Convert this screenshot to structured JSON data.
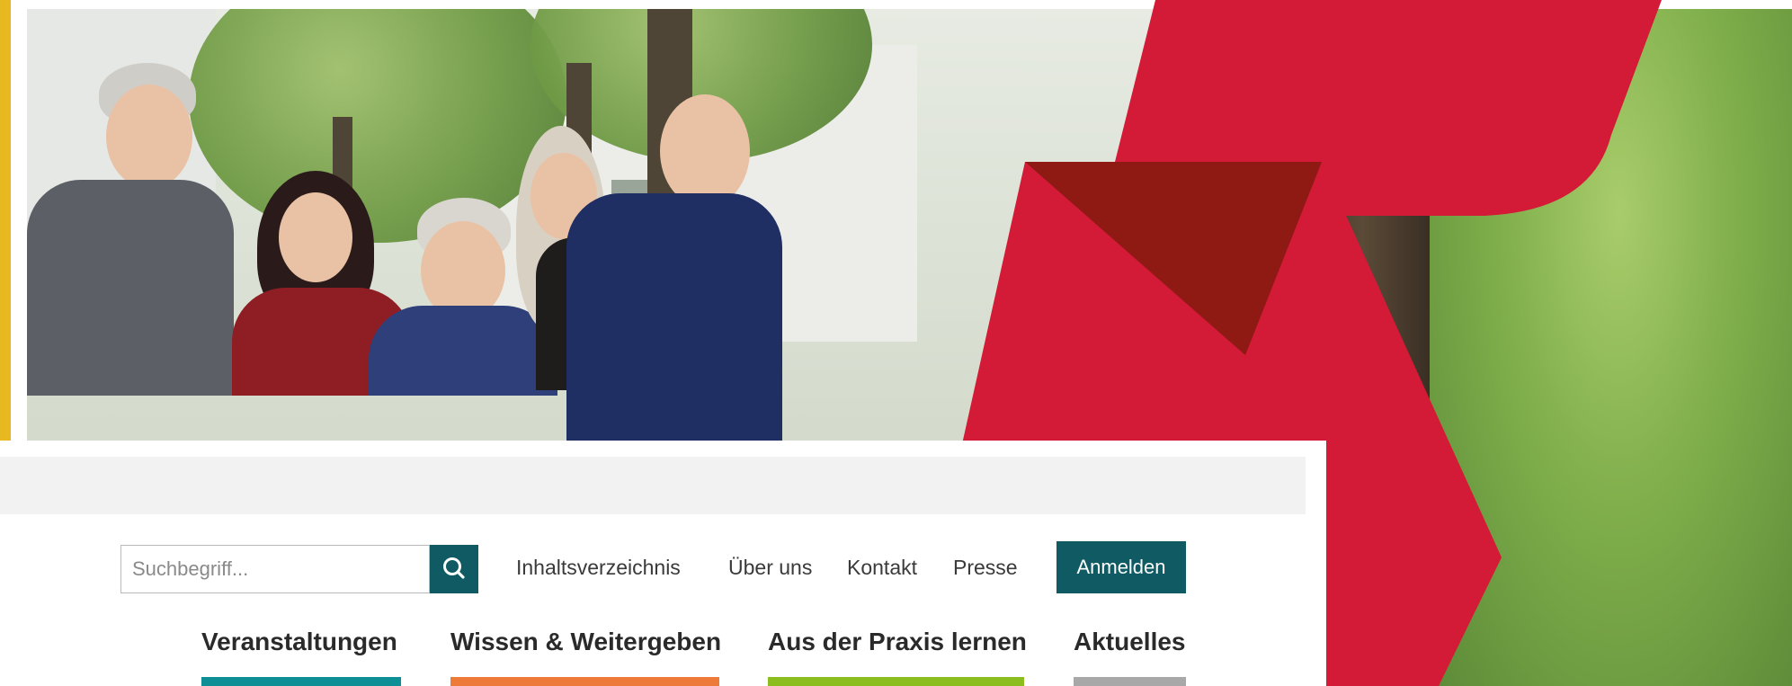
{
  "colors": {
    "accent_stripe": "#e8b820",
    "brand_red": "#d31a36",
    "brand_dark_red": "#8f1913",
    "teal": "#0f5a63",
    "nav_veranstaltungen": "#0e8f96",
    "nav_wissen": "#ee7a3a",
    "nav_praxis": "#8cbd1f",
    "nav_aktuelles": "#a8a8a8"
  },
  "header": {
    "search": {
      "placeholder": "Suchbegriff...",
      "value": "",
      "button_icon": "search-icon"
    },
    "utility_links": [
      {
        "label": "Inhaltsverzeichnis"
      },
      {
        "label": "Über uns"
      },
      {
        "label": "Kontakt"
      },
      {
        "label": "Presse"
      }
    ],
    "login_label": "Anmelden"
  },
  "main_nav": {
    "items": [
      {
        "label": "Veranstaltungen",
        "color": "#0e8f96"
      },
      {
        "label": "Wissen & Weitergeben",
        "color": "#ee7a3a"
      },
      {
        "label": "Aus der Praxis lernen",
        "color": "#8cbd1f"
      },
      {
        "label": "Aktuelles",
        "color": "#a8a8a8"
      }
    ]
  }
}
